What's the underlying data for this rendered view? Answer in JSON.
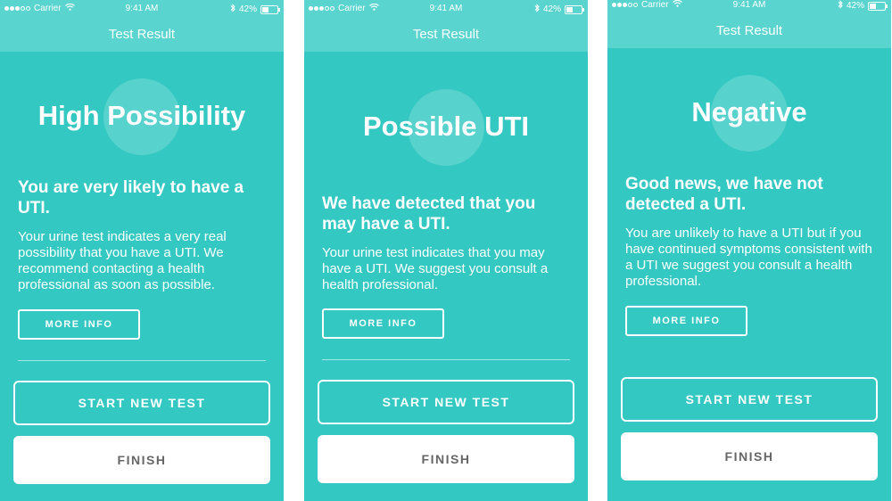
{
  "colors": {
    "background": "#34c8c2",
    "header": "#5ad4cf",
    "text": "#ffffff",
    "finish_text": "#666666"
  },
  "screens": [
    {
      "status": {
        "carrier": "Carrier",
        "time": "9:41 AM",
        "battery": "42%",
        "battery_level": 0.42
      },
      "nav_title": "Test Result",
      "result_title": "High Possibility",
      "headline": "You are very likely to have a UTI.",
      "body": "Your urine test indicates a very real possibility that you have a UTI. We recommend contacting a health professional as soon as possible.",
      "more_info": "MORE INFO",
      "start_new_test": "START NEW TEST",
      "finish": "FINISH"
    },
    {
      "status": {
        "carrier": "Carrier",
        "time": "9:41 AM",
        "battery": "42%",
        "battery_level": 0.42
      },
      "nav_title": "Test Result",
      "result_title": "Possible UTI",
      "headline": "We have detected that you may have a UTI.",
      "body": "Your urine test indicates that you may have a UTI. We suggest you consult a health professional.",
      "more_info": "MORE INFO",
      "start_new_test": "START NEW TEST",
      "finish": "FINISH"
    },
    {
      "status": {
        "carrier": "Carrier",
        "time": "9:41 AM",
        "battery": "42%",
        "battery_level": 0.42
      },
      "nav_title": "Test Result",
      "result_title": "Negative",
      "headline": "Good news, we have not detected a UTI.",
      "body": "You are unlikely to have a UTI but if you have continued symptoms consistent with a UTI we suggest you consult a health professional.",
      "more_info": "MORE INFO",
      "start_new_test": "START NEW TEST",
      "finish": "FINISH"
    }
  ]
}
